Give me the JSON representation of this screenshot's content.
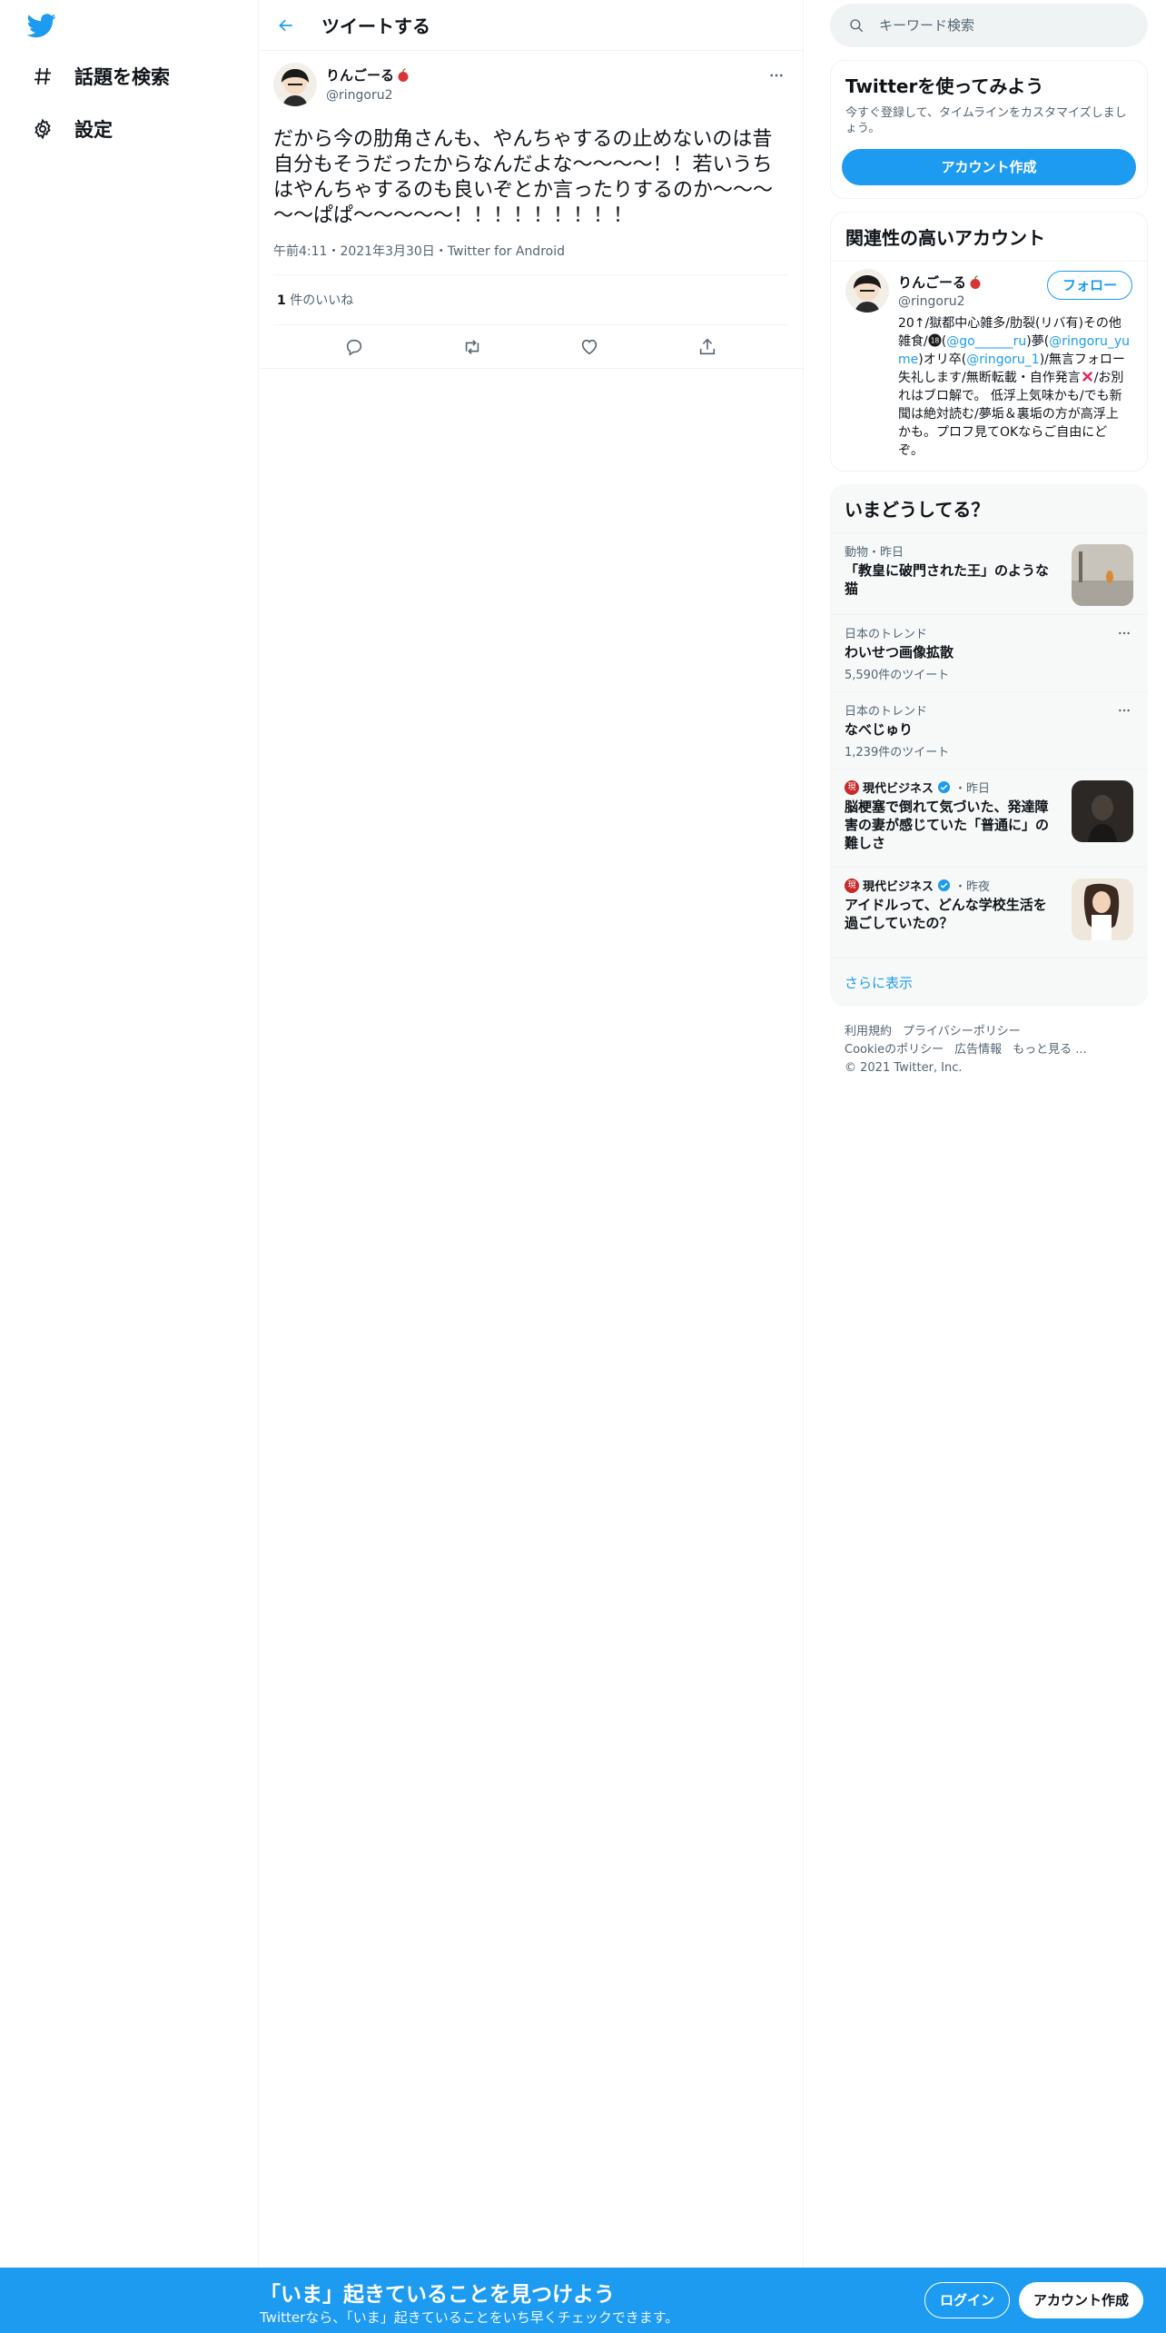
{
  "nav": {
    "items": [
      {
        "label": "話題を検索",
        "icon": "hashtag-icon"
      },
      {
        "label": "設定",
        "icon": "gear-icon"
      }
    ]
  },
  "header": {
    "title": "ツイートする"
  },
  "tweet": {
    "author_name": "りんごーる",
    "author_handle": "@ringoru2",
    "text": "だから今の肋角さんも、やんちゃするの止めないのは昔自分もそうだったからなんだよな～～～～！！若いうちはやんちゃするのも良いぞとか言ったりするのか～～～～～ぱぱ～～～～～！！！！！！！！！",
    "meta": "午前4:11・2021年3月30日・Twitter for Android",
    "likes_count": "1",
    "likes_label": " 件のいいね"
  },
  "search": {
    "placeholder": "キーワード検索"
  },
  "signup_card": {
    "title": "Twitterを使ってみよう",
    "desc": "今すぐ登録して、タイムラインをカスタマイズしましょう。",
    "button": "アカウント作成"
  },
  "related": {
    "title": "関連性の高いアカウント",
    "name": "りんごーる",
    "handle": "@ringoru2",
    "follow": "フォロー",
    "bio_1": "20↑/獄都中心雑多/肋裂(リバ有)その他雑食/",
    "bio_2": "(",
    "mention_1": "@go______ru",
    "bio_3": ")夢(",
    "mention_2": "@ringoru_yume",
    "bio_4": ")オリ卒(",
    "mention_3": "@ringoru_1",
    "bio_5": ")/無言フォロー失礼します/無断転載・自作発言",
    "bio_6": "/お別れはブロ解で。 低浮上気味かも/でも新聞は絶対読む/夢垢＆裏垢の方が高浮上かも。プロフ見てOKならご自由にどぞ。"
  },
  "trends": {
    "title": "いまどうしてる？",
    "items": [
      {
        "meta": "動物・昨日",
        "title": "「教皇に破門された王」のような猫",
        "thumb": true
      },
      {
        "meta": "日本のトレンド",
        "title": "わいせつ画像拡散",
        "count": "5,590件のツイート"
      },
      {
        "meta": "日本のトレンド",
        "title": "なべじゅり",
        "count": "1,239件のツイート"
      },
      {
        "source": "現代ビジネス",
        "time": "・昨日",
        "title": "脳梗塞で倒れて気づいた、発達障害の妻が感じていた「普通に」の難しさ"
      },
      {
        "source": "現代ビジネス",
        "time": "・昨夜",
        "title": "アイドルって、どんな学校生活を過ごしていたの？"
      }
    ],
    "show_more": "さらに表示"
  },
  "footer": {
    "terms": "利用規約",
    "privacy": "プライバシーポリシー",
    "cookie": "Cookieのポリシー",
    "ads": "広告情報",
    "more": "もっと見る ...",
    "copyright": "© 2021 Twitter, Inc."
  },
  "bottombar": {
    "title": "「いま」起きていることを見つけよう",
    "subtitle": "Twitterなら、「いま」起きていることをいち早くチェックできます。",
    "login": "ログイン",
    "signup": "アカウント作成"
  },
  "colors": {
    "accent": "#1d9bf0",
    "text": "#0f1419",
    "muted": "#536471"
  }
}
